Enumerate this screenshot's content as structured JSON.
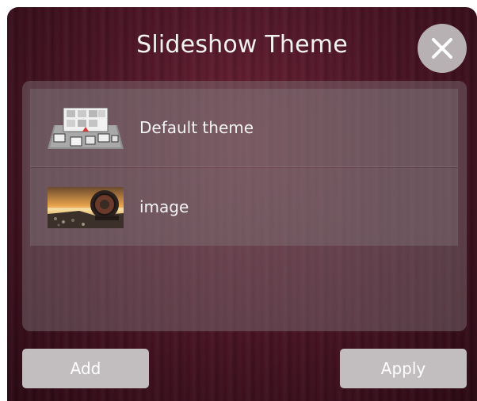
{
  "dialog": {
    "title": "Slideshow Theme",
    "close_icon": "close-icon"
  },
  "themes": [
    {
      "label": "Default theme",
      "thumbnail": "default-theme-thumbnail"
    },
    {
      "label": "image",
      "thumbnail": "image-thumbnail"
    }
  ],
  "buttons": {
    "add_label": "Add",
    "apply_label": "Apply"
  },
  "colors": {
    "background": "#4c1526",
    "button": "#c2bdbf",
    "close_button": "#b7b1b3"
  }
}
